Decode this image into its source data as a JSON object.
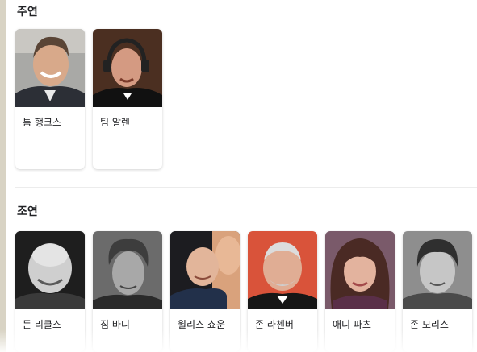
{
  "main_cast": {
    "title": "주연",
    "people": [
      {
        "name": "톰 행크스",
        "icon": "person-photo"
      },
      {
        "name": "팀 알렌",
        "icon": "person-photo"
      }
    ]
  },
  "supporting_cast": {
    "title": "조연",
    "people": [
      {
        "name": "돈 리클스",
        "icon": "person-photo"
      },
      {
        "name": "짐 바니",
        "icon": "person-photo"
      },
      {
        "name": "윌리스 쇼운",
        "icon": "person-photo"
      },
      {
        "name": "존 라첸버",
        "icon": "person-photo"
      },
      {
        "name": "애니 파츠",
        "icon": "person-photo"
      },
      {
        "name": "존 모리스",
        "icon": "person-photo"
      }
    ]
  }
}
